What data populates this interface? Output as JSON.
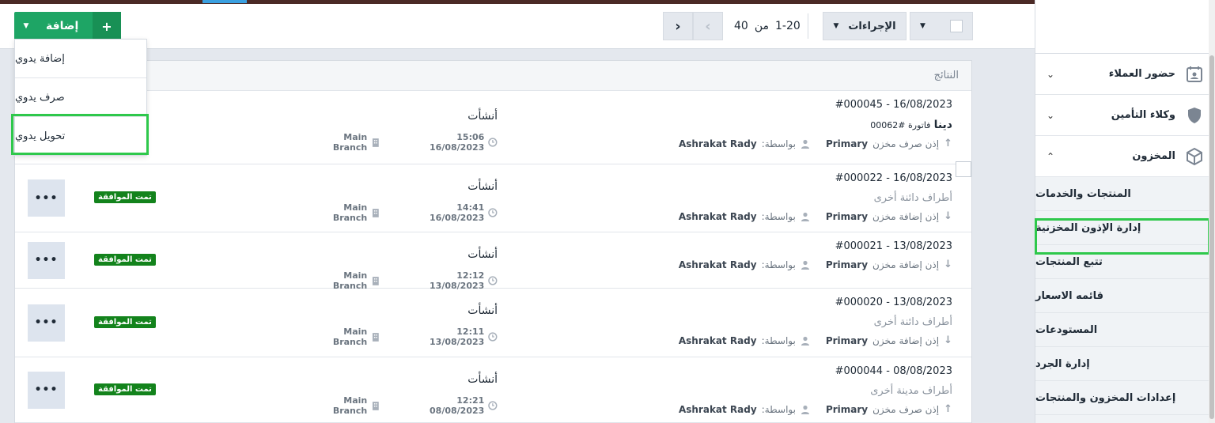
{
  "toolbar": {
    "add_label": "إضافة",
    "pager_range": "1-20",
    "pager_of": "من",
    "pager_total": "40",
    "actions_label": "الإجراءات"
  },
  "dropdown": {
    "items": [
      "إضافة يدوي",
      "صرف يدوي",
      "تحويل يدوي"
    ]
  },
  "results": {
    "heading": "النتائج",
    "rows": [
      {
        "date_num": "16/08/2023 - #000045",
        "line2_name": "دينا",
        "line2_extra": "فاتورة #00062",
        "type": "إذن صرف مخزن",
        "warehouse": "Primary",
        "by_label": "بواسطة:",
        "user": "Ashrakat Rady",
        "status_text": "أنشأت",
        "datetime": "15:06 16/08/2023",
        "branch": "Main Branch",
        "badge": ""
      },
      {
        "date_num": "16/08/2023 - #000022",
        "line2": "أطراف دائنة أخرى",
        "type": "إذن إضافة مخزن",
        "warehouse": "Primary",
        "by_label": "بواسطة:",
        "user": "Ashrakat Rady",
        "status_text": "أنشأت",
        "datetime": "14:41 16/08/2023",
        "branch": "Main Branch",
        "badge": "تمت الموافقة"
      },
      {
        "date_num": "13/08/2023 - #000021",
        "line2": "",
        "type": "إذن إضافة مخزن",
        "warehouse": "Primary",
        "by_label": "بواسطة:",
        "user": "Ashrakat Rady",
        "status_text": "أنشأت",
        "datetime": "12:12 13/08/2023",
        "branch": "Main Branch",
        "badge": "تمت الموافقة"
      },
      {
        "date_num": "13/08/2023 - #000020",
        "line2": "أطراف دائنة أخرى",
        "type": "إذن إضافة مخزن",
        "warehouse": "Primary",
        "by_label": "بواسطة:",
        "user": "Ashrakat Rady",
        "status_text": "أنشأت",
        "datetime": "12:11 13/08/2023",
        "branch": "Main Branch",
        "badge": "تمت الموافقة"
      },
      {
        "date_num": "08/08/2023 - #000044",
        "line2": "أطراف مدينة أخرى",
        "type": "إذن صرف مخزن",
        "warehouse": "Primary",
        "by_label": "بواسطة:",
        "user": "Ashrakat Rady",
        "status_text": "أنشأت",
        "datetime": "12:21 08/08/2023",
        "branch": "Main Branch",
        "badge": "تمت الموافقة"
      }
    ]
  },
  "sidebar": {
    "main_items": [
      "حضور العملاء",
      "وكلاء التأمين",
      "المخزون"
    ],
    "sub_items": [
      "المنتجات والخدمات",
      "إدارة الإذون المخزنية",
      "تتبع المنتجات",
      "قائمه الاسعار",
      "المستودعات",
      "إدارة الجرد",
      "إعدادات المخزون والمنتجات"
    ]
  }
}
